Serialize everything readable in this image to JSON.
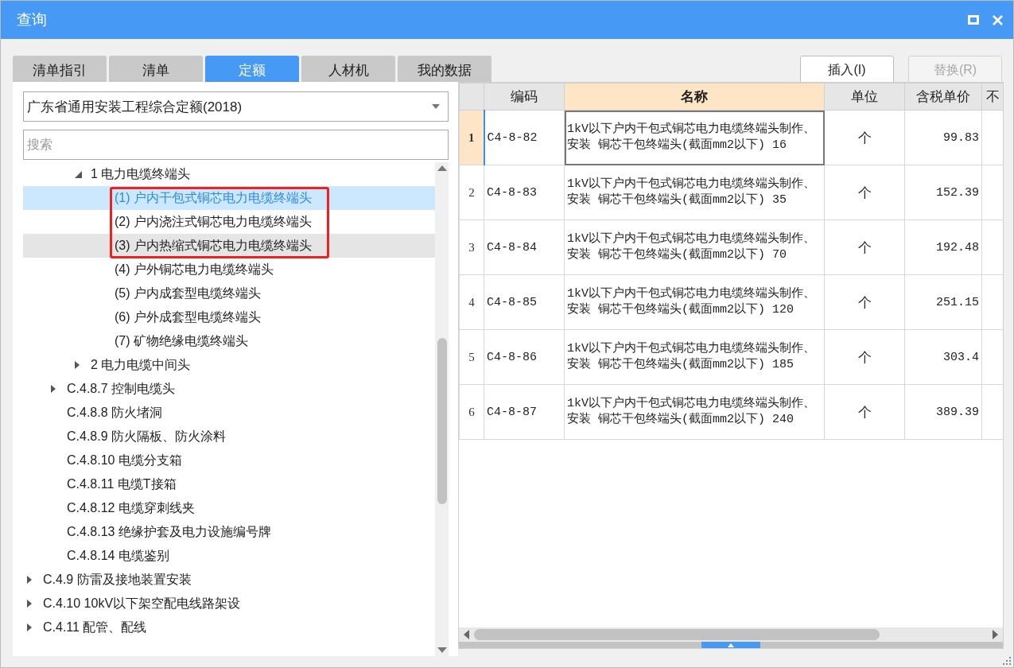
{
  "window": {
    "title": "查询"
  },
  "tabs": [
    {
      "label": "清单指引",
      "selected": false
    },
    {
      "label": "清单",
      "selected": false
    },
    {
      "label": "定额",
      "selected": true
    },
    {
      "label": "人材机",
      "selected": false
    },
    {
      "label": "我的数据",
      "selected": false
    }
  ],
  "buttons": [
    {
      "label": "插入(I)",
      "disabled": false
    },
    {
      "label": "替换(R)",
      "disabled": true
    }
  ],
  "library_select": {
    "value": "广东省通用安装工程综合定额(2018)"
  },
  "search": {
    "placeholder": "搜索"
  },
  "tree": {
    "items": [
      {
        "children": [
          {
            "children": [
              {
                "label": "1 电力电缆终端头",
                "expanded": true,
                "selected": false,
                "hovered": false,
                "children": [
                  {
                    "label": "(1) 户内干包式铜芯电力电缆终端头",
                    "selected": true,
                    "hovered": false,
                    "framed": true
                  },
                  {
                    "label": "(2) 户内浇注式铜芯电力电缆终端头",
                    "selected": false,
                    "hovered": false,
                    "framed": true
                  },
                  {
                    "label": "(3) 户内热缩式铜芯电力电缆终端头",
                    "selected": false,
                    "hovered": true,
                    "framed": true
                  },
                  {
                    "label": "(4) 户外铜芯电力电缆终端头",
                    "selected": false,
                    "hovered": false,
                    "framed": false
                  },
                  {
                    "label": "(5) 户内成套型电缆终端头",
                    "selected": false,
                    "hovered": false,
                    "framed": false
                  },
                  {
                    "label": "(6) 户外成套型电缆终端头",
                    "selected": false,
                    "hovered": false,
                    "framed": false
                  },
                  {
                    "label": "(7) 矿物绝缘电缆终端头",
                    "selected": false,
                    "hovered": false,
                    "framed": false
                  }
                ]
              },
              {
                "label": "2 电力电缆中间头",
                "expanded": false,
                "selected": false,
                "hovered": false
              }
            ]
          },
          {
            "label": "C.4.8.7 控制电缆头",
            "expanded": false,
            "selected": false,
            "hovered": false
          },
          {
            "label": "C.4.8.8 防火堵洞",
            "selected": false,
            "hovered": false
          },
          {
            "label": "C.4.8.9 防火隔板、防火涂料",
            "selected": false,
            "hovered": false
          },
          {
            "label": "C.4.8.10 电缆分支箱",
            "selected": false,
            "hovered": false
          },
          {
            "label": "C.4.8.11 电缆T接箱",
            "selected": false,
            "hovered": false
          },
          {
            "label": "C.4.8.12 电缆穿刺线夹",
            "selected": false,
            "hovered": false
          },
          {
            "label": "C.4.8.13 绝缘护套及电力设施编号牌",
            "selected": false,
            "hovered": false
          },
          {
            "label": "C.4.8.14 电缆鉴别",
            "selected": false,
            "hovered": false
          }
        ]
      },
      {
        "label": "C.4.9 防雷及接地装置安装",
        "expanded": false,
        "selected": false,
        "hovered": false
      },
      {
        "label": "C.4.10 10kV以下架空配电线路架设",
        "expanded": false,
        "selected": false,
        "hovered": false
      },
      {
        "label": "C.4.11 配管、配线",
        "expanded": false,
        "selected": false,
        "hovered": false
      }
    ]
  },
  "table": {
    "columns": [
      {
        "label": "编码",
        "selected": false
      },
      {
        "label": "名称",
        "selected": true
      },
      {
        "label": "单位",
        "selected": false
      },
      {
        "label": "含税单价",
        "selected": false
      },
      {
        "label": "不",
        "selected": false
      }
    ],
    "rows": [
      {
        "number": "1",
        "selected": true,
        "cells": [
          "C4-8-82",
          "1kV以下户内干包式铜芯电力电缆终端头制作、安装 铜芯干包终端头(截面mm2以下) 16",
          "个",
          "99.83"
        ]
      },
      {
        "number": "2",
        "selected": false,
        "cells": [
          "C4-8-83",
          "1kV以下户内干包式铜芯电力电缆终端头制作、安装 铜芯干包终端头(截面mm2以下) 35",
          "个",
          "152.39"
        ]
      },
      {
        "number": "3",
        "selected": false,
        "cells": [
          "C4-8-84",
          "1kV以下户内干包式铜芯电力电缆终端头制作、安装 铜芯干包终端头(截面mm2以下) 70",
          "个",
          "192.48"
        ]
      },
      {
        "number": "4",
        "selected": false,
        "cells": [
          "C4-8-85",
          "1kV以下户内干包式铜芯电力电缆终端头制作、安装 铜芯干包终端头(截面mm2以下) 120",
          "个",
          "251.15"
        ]
      },
      {
        "number": "5",
        "selected": false,
        "cells": [
          "C4-8-86",
          "1kV以下户内干包式铜芯电力电缆终端头制作、安装 铜芯干包终端头(截面mm2以下) 185",
          "个",
          "303.4"
        ]
      },
      {
        "number": "6",
        "selected": false,
        "cells": [
          "C4-8-87",
          "1kV以下户内干包式铜芯电力电缆终端头制作、安装 铜芯干包终端头(截面mm2以下) 240",
          "个",
          "389.39"
        ]
      }
    ]
  }
}
